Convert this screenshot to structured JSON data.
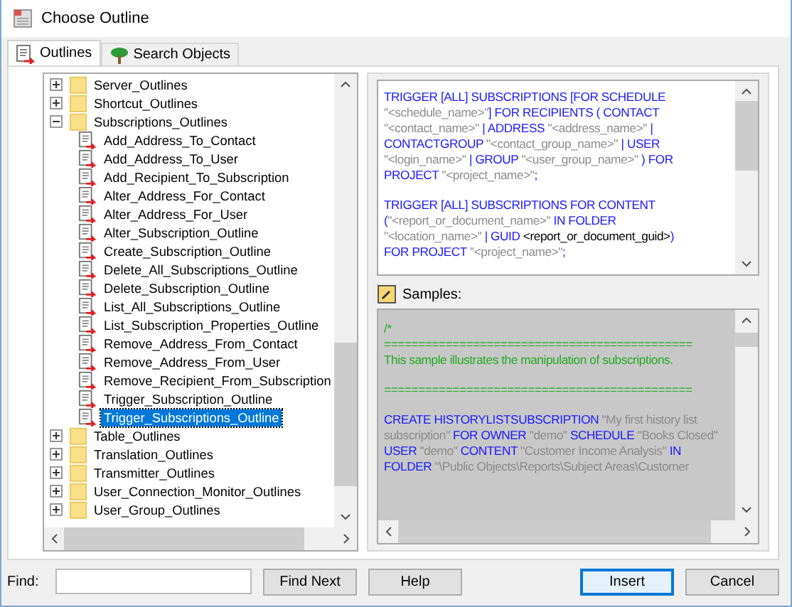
{
  "window": {
    "title": "Choose Outline"
  },
  "tabs": [
    {
      "label": "Outlines",
      "selected": true
    },
    {
      "label": "Search Objects",
      "selected": false
    }
  ],
  "tree": {
    "items": [
      {
        "label": "Server_Outlines",
        "expanded": false
      },
      {
        "label": "Shortcut_Outlines",
        "expanded": false
      },
      {
        "label": "Subscriptions_Outlines",
        "expanded": true,
        "children": [
          {
            "label": "Add_Address_To_Contact",
            "selected": false
          },
          {
            "label": "Add_Address_To_User",
            "selected": false
          },
          {
            "label": "Add_Recipient_To_Subscription",
            "selected": false
          },
          {
            "label": "Alter_Address_For_Contact",
            "selected": false
          },
          {
            "label": "Alter_Address_For_User",
            "selected": false
          },
          {
            "label": "Alter_Subscription_Outline",
            "selected": false
          },
          {
            "label": "Create_Subscription_Outline",
            "selected": false
          },
          {
            "label": "Delete_All_Subscriptions_Outline",
            "selected": false
          },
          {
            "label": "Delete_Subscription_Outline",
            "selected": false
          },
          {
            "label": "List_All_Subscriptions_Outline",
            "selected": false
          },
          {
            "label": "List_Subscription_Properties_Outline",
            "selected": false
          },
          {
            "label": "Remove_Address_From_Contact",
            "selected": false
          },
          {
            "label": "Remove_Address_From_User",
            "selected": false
          },
          {
            "label": "Remove_Recipient_From_Subscription",
            "selected": false
          },
          {
            "label": "Trigger_Subscription_Outline",
            "selected": false
          },
          {
            "label": "Trigger_Subscriptions_Outline",
            "selected": true
          }
        ]
      },
      {
        "label": "Table_Outlines",
        "expanded": false
      },
      {
        "label": "Translation_Outlines",
        "expanded": false
      },
      {
        "label": "Transmitter_Outlines",
        "expanded": false
      },
      {
        "label": "User_Connection_Monitor_Outlines",
        "expanded": false
      },
      {
        "label": "User_Group_Outlines",
        "expanded": false
      }
    ]
  },
  "syntax": {
    "paragraphs": [
      [
        [
          {
            "kind": "keyword",
            "text": "TRIGGER [ALL] SUBSCRIPTIONS [FOR SCHEDULE"
          }
        ],
        [
          {
            "kind": "string",
            "text": "\"<schedule_name>\""
          },
          {
            "kind": "keyword",
            "text": "] FOR RECIPIENTS ( CONTACT"
          }
        ],
        [
          {
            "kind": "string",
            "text": "\"<contact_name>\""
          },
          {
            "kind": "keyword",
            "text": " | ADDRESS "
          },
          {
            "kind": "string",
            "text": "\"<address_name>\""
          },
          {
            "kind": "keyword",
            "text": " |"
          }
        ],
        [
          {
            "kind": "keyword",
            "text": "CONTACTGROUP "
          },
          {
            "kind": "string",
            "text": "\"<contact_group_name>\""
          },
          {
            "kind": "keyword",
            "text": " | USER"
          }
        ],
        [
          {
            "kind": "string",
            "text": "\"<login_name>\""
          },
          {
            "kind": "keyword",
            "text": " | GROUP "
          },
          {
            "kind": "string",
            "text": "\"<user_group_name>\""
          },
          {
            "kind": "keyword",
            "text": " ) FOR"
          }
        ],
        [
          {
            "kind": "keyword",
            "text": "PROJECT "
          },
          {
            "kind": "string",
            "text": "\"<project_name>\""
          },
          {
            "kind": "keyword",
            "text": ";"
          }
        ]
      ],
      [
        [
          {
            "kind": "keyword",
            "text": "TRIGGER [ALL] SUBSCRIPTIONS FOR CONTENT"
          }
        ],
        [
          {
            "kind": "keyword",
            "text": "("
          },
          {
            "kind": "string",
            "text": "\"<report_or_document_name>\""
          },
          {
            "kind": "keyword",
            "text": " IN FOLDER"
          }
        ],
        [
          {
            "kind": "string",
            "text": "\"<location_name>\""
          },
          {
            "kind": "keyword",
            "text": " | GUID "
          },
          {
            "kind": "plain",
            "text": "<report_or_document_guid>"
          },
          {
            "kind": "keyword",
            "text": ")"
          }
        ],
        [
          {
            "kind": "keyword",
            "text": "FOR PROJECT "
          },
          {
            "kind": "string",
            "text": "\"<project_name>\""
          },
          {
            "kind": "keyword",
            "text": ";"
          }
        ]
      ]
    ]
  },
  "samples": {
    "label": "Samples:",
    "paragraphs": [
      [
        [
          {
            "kind": "comment",
            "text": "/*"
          }
        ],
        [
          {
            "kind": "comment",
            "text": "============================================="
          }
        ],
        [
          {
            "kind": "comment",
            "text": "This sample illustrates the manipulation of subscriptions."
          }
        ]
      ],
      [
        [
          {
            "kind": "comment",
            "text": "============================================="
          }
        ]
      ],
      [
        [
          {
            "kind": "keyword",
            "text": "CREATE HISTORYLISTSUBSCRIPTION "
          },
          {
            "kind": "string",
            "text": "\"My first history list"
          }
        ],
        [
          {
            "kind": "string",
            "text": "subscription\""
          },
          {
            "kind": "keyword",
            "text": " FOR OWNER "
          },
          {
            "kind": "string",
            "text": "\"demo\""
          },
          {
            "kind": "keyword",
            "text": " SCHEDULE "
          },
          {
            "kind": "string",
            "text": "\"Books Closed\""
          }
        ],
        [
          {
            "kind": "keyword",
            "text": "USER "
          },
          {
            "kind": "string",
            "text": "\"demo\""
          },
          {
            "kind": "keyword",
            "text": " CONTENT "
          },
          {
            "kind": "string",
            "text": "\"Customer Income Analysis\""
          },
          {
            "kind": "keyword",
            "text": " IN"
          }
        ],
        [
          {
            "kind": "keyword",
            "text": "FOLDER "
          },
          {
            "kind": "string",
            "text": "\"\\Public Objects\\Reports\\Subject Areas\\Customer"
          }
        ]
      ]
    ]
  },
  "find": {
    "label": "Find:"
  },
  "buttons": [
    {
      "label": "Find Next",
      "kind": "find"
    },
    {
      "label": "Help",
      "kind": "help"
    },
    {
      "label": "Insert",
      "kind": "default"
    },
    {
      "label": "Cancel",
      "kind": "cancel"
    }
  ]
}
